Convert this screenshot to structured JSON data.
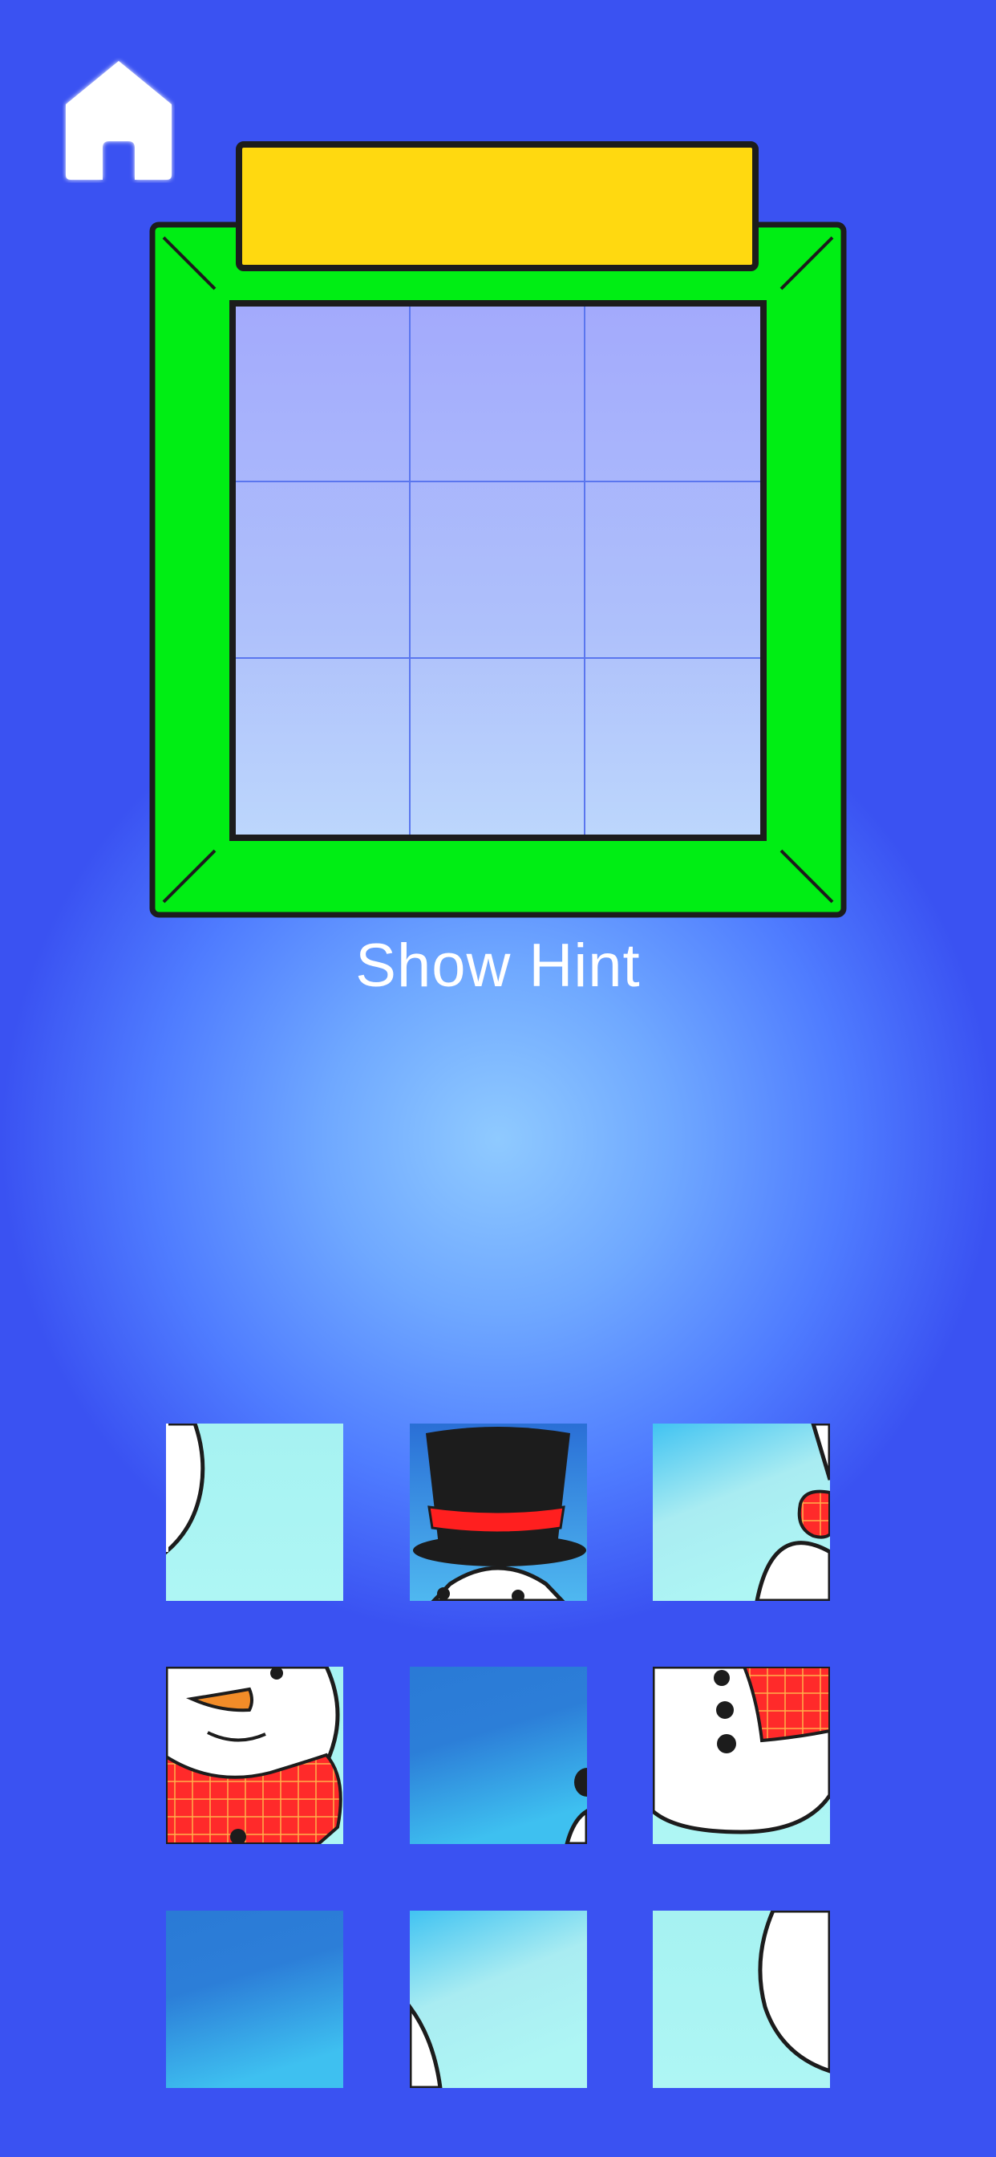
{
  "screen": {
    "title_text": "",
    "hint_label": "Show Hint"
  },
  "icons": {
    "home": "home-icon"
  },
  "colors": {
    "frame_green": "#00ee14",
    "title_bar_yellow": "#ffd910",
    "outline": "#1c1c1c",
    "scarf_red": "#ff2a2a",
    "carrot_orange": "#f28c28"
  },
  "board": {
    "rows": 3,
    "cols": 3,
    "filled_slots": 0
  },
  "pieces": [
    {
      "id": "piece-1",
      "content": "snowman-left-edge"
    },
    {
      "id": "piece-2",
      "content": "top-hat"
    },
    {
      "id": "piece-3",
      "content": "snowman-shoulder-scarf"
    },
    {
      "id": "piece-4",
      "content": "snowman-face-scarf"
    },
    {
      "id": "piece-5",
      "content": "sky-with-arm-edge"
    },
    {
      "id": "piece-6",
      "content": "snowman-body-buttons"
    },
    {
      "id": "piece-7",
      "content": "sky-plain"
    },
    {
      "id": "piece-8",
      "content": "sky-with-body-edge"
    },
    {
      "id": "piece-9",
      "content": "snowman-base-edge"
    }
  ]
}
